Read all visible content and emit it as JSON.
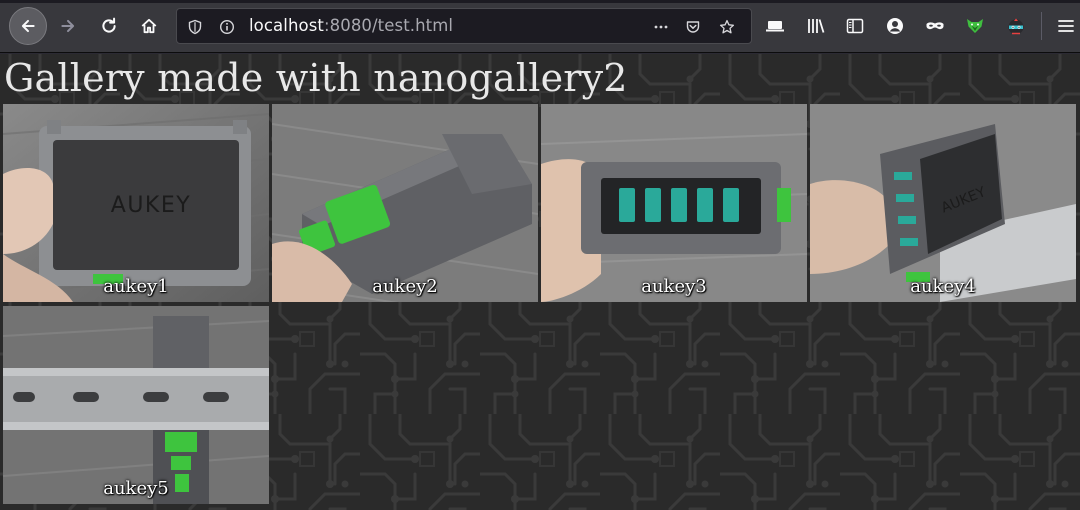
{
  "browser": {
    "url_host": "localhost",
    "url_rest": ":8080/test.html"
  },
  "page": {
    "title": "Gallery made with nanogallery2"
  },
  "gallery": {
    "items": [
      {
        "label": "aukey1",
        "brand_text": "AUKEY"
      },
      {
        "label": "aukey2"
      },
      {
        "label": "aukey3"
      },
      {
        "label": "aukey4",
        "brand_text": "AUKEY"
      },
      {
        "label": "aukey5"
      }
    ]
  }
}
